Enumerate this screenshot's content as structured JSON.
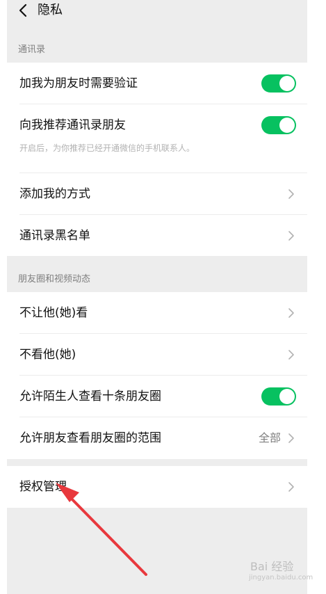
{
  "header": {
    "title": "隐私"
  },
  "sections": {
    "contacts": {
      "label": "通讯录",
      "rows": [
        {
          "label": "加我为朋友时需要验证",
          "toggle_on": true
        },
        {
          "label": "向我推荐通讯录朋友",
          "toggle_on": true,
          "desc": "开启后，为你推荐已经开通微信的手机联系人。"
        },
        {
          "label": "添加我的方式"
        },
        {
          "label": "通讯录黑名单"
        }
      ]
    },
    "moments": {
      "label": "朋友圈和视频动态",
      "rows": [
        {
          "label": "不让他(她)看"
        },
        {
          "label": "不看他(她)"
        },
        {
          "label": "允许陌生人查看十条朋友圈",
          "toggle_on": true
        },
        {
          "label": "允许朋友查看朋友圈的范围",
          "value": "全部"
        }
      ]
    },
    "auth": {
      "rows": [
        {
          "label": "授权管理"
        }
      ]
    }
  },
  "watermark": {
    "text": "Bai 经验",
    "sub": "jingyan.baidu.com"
  },
  "colors": {
    "accent": "#07c160",
    "background": "#ededed",
    "annotation_arrow": "#e8383d"
  }
}
